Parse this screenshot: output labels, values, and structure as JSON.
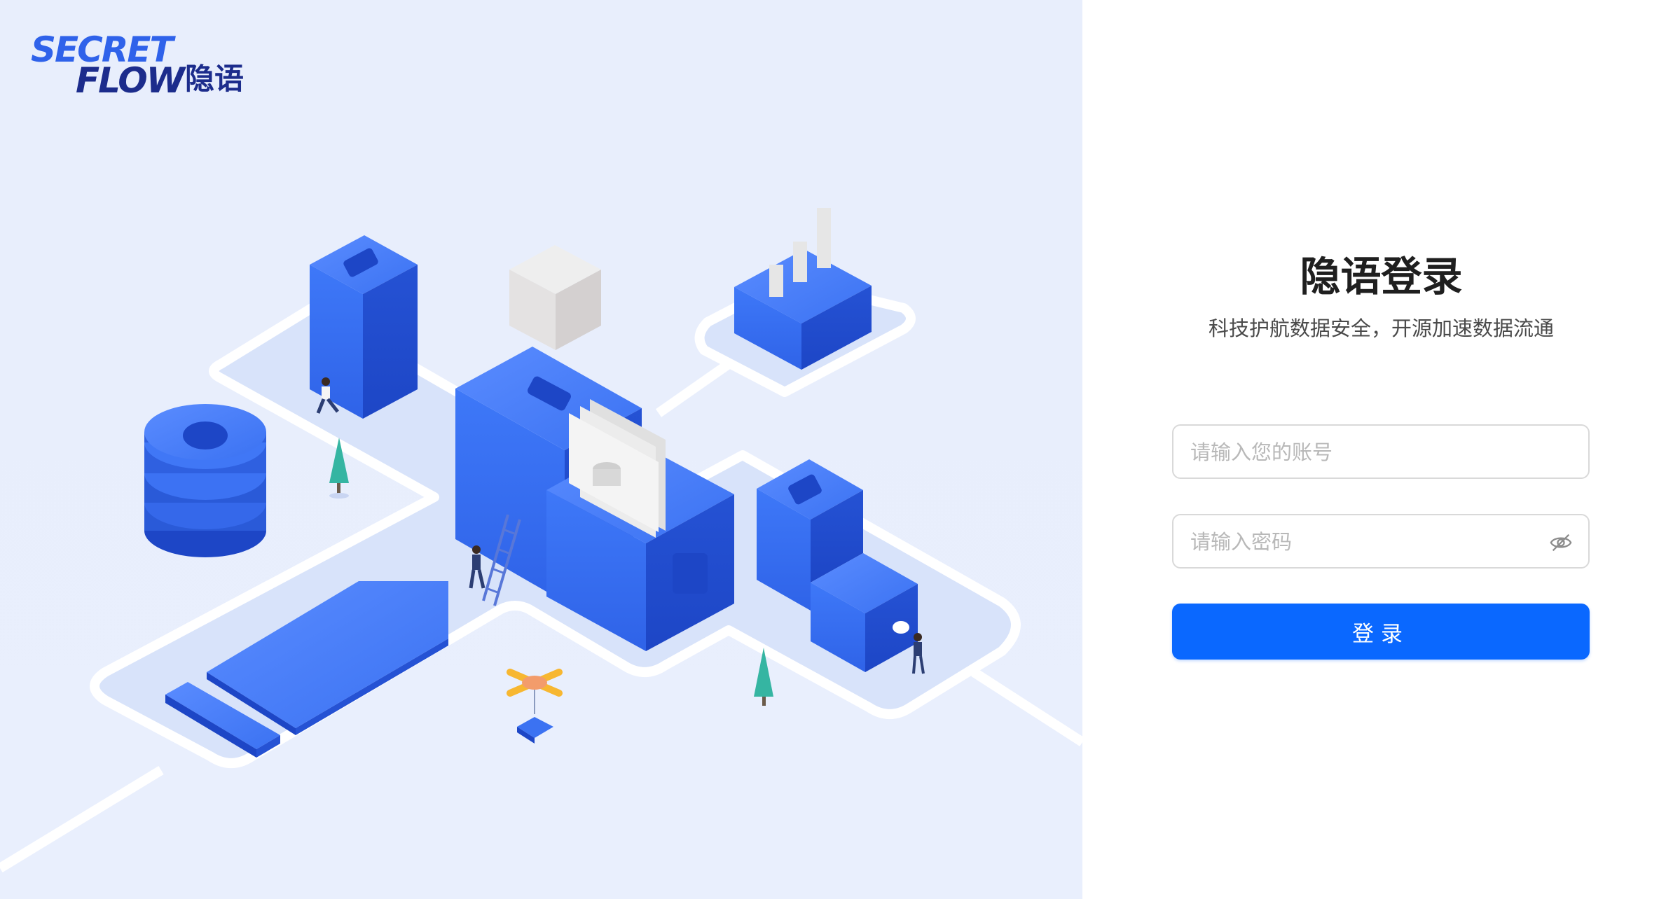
{
  "brand": {
    "logo_line1": "SECRET",
    "logo_line2": "FLOW",
    "logo_cn": "隐语"
  },
  "login": {
    "title": "隐语登录",
    "subtitle": "科技护航数据安全，开源加速数据流通",
    "username_placeholder": "请输入您的账号",
    "username_value": "",
    "password_placeholder": "请输入密码",
    "password_value": "",
    "password_toggle_icon": "eye-off-icon",
    "submit_label": "登录"
  },
  "colors": {
    "primary": "#0a68ff",
    "left_panel_bg": "#e8eefc",
    "illustration_blue": "#3570f3",
    "logo_blue": "#2f62ea",
    "logo_navy": "#1c2c8c"
  }
}
